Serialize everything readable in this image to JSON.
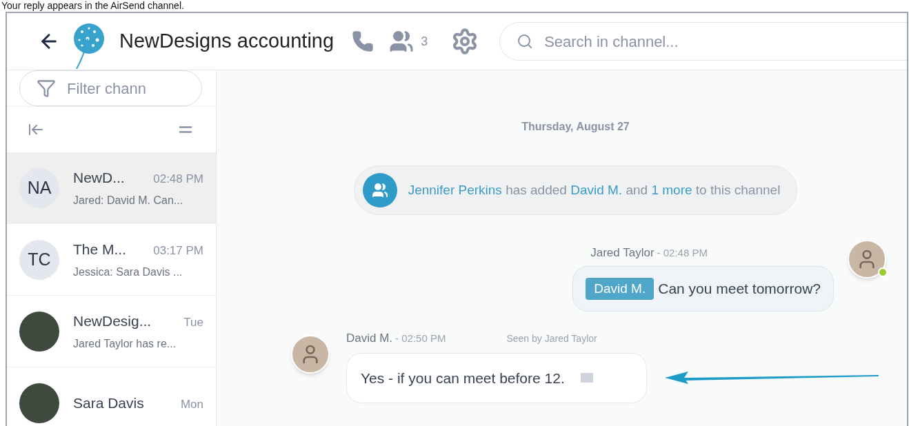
{
  "caption": "Your reply appears in the AirSend channel.",
  "header": {
    "title": "NewDesigns accounting",
    "member_count": "3",
    "search_placeholder": "Search in channel..."
  },
  "sidebar": {
    "filter_placeholder": "Filter chann",
    "channels": [
      {
        "kind": "initials",
        "initials": "NA",
        "name": "NewD...",
        "time": "02:48 PM",
        "preview": "Jared: David M. Can...",
        "selected": true
      },
      {
        "kind": "initials",
        "initials": "TC",
        "name": "The M...",
        "time": "03:17 PM",
        "preview": "Jessica: Sara Davis ...",
        "selected": false
      },
      {
        "kind": "photo",
        "name": "NewDesig...",
        "time": "Tue",
        "preview": "Jared Taylor has re...",
        "selected": false
      },
      {
        "kind": "photo",
        "name": "Sara Davis",
        "time": "Mon",
        "selected": false
      }
    ]
  },
  "chat": {
    "date": "Thursday, August 27",
    "system_message": [
      {
        "kind": "link",
        "text": "Jennifer Perkins"
      },
      {
        "kind": "text",
        "text": " has added "
      },
      {
        "kind": "link",
        "text": "David M."
      },
      {
        "kind": "text",
        "text": " and "
      },
      {
        "kind": "link",
        "text": "1 more"
      },
      {
        "kind": "text",
        "text": " to this channel"
      }
    ],
    "messages": [
      {
        "kind": "outgoing",
        "sender": "Jared Taylor",
        "time": "- 02:48 PM",
        "mention": "David M.",
        "text": "Can you meet tomorrow?",
        "online": true
      },
      {
        "kind": "incoming",
        "sender": "David M.",
        "time": "- 02:50 PM",
        "seen": "Seen by Jared Taylor",
        "text": "Yes - if you can meet before 12.",
        "online": false
      }
    ]
  }
}
